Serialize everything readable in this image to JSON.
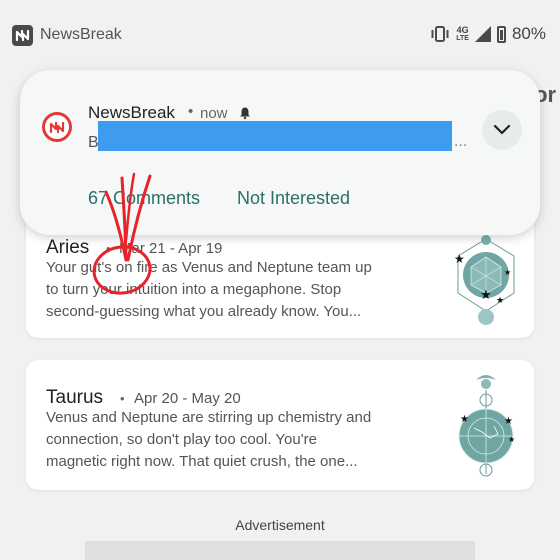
{
  "statusbar": {
    "app_name": "NewsBreak",
    "network": "4G",
    "network_sub": "LTE",
    "battery": "80%"
  },
  "background_peek": {
    "edge_text": "lor"
  },
  "notification": {
    "app_name": "NewsBreak",
    "separator": "•",
    "time": "now",
    "preview_start": "B",
    "preview_end": "...",
    "actions": {
      "comments": "67 Comments",
      "not_interested": "Not Interested"
    },
    "colors": {
      "action": "#2c6f68",
      "redaction": "#3d9bf0",
      "annotation": "#e8222a"
    }
  },
  "feed": [
    {
      "sign": "Aries",
      "dot": "•",
      "dates": "Mar 21 - Apr 19",
      "lines": [
        "Your gut's on fire as Venus and Neptune team up",
        "to turn your intuition into a megaphone. Stop",
        "second-guessing what you already know. You..."
      ],
      "icon": "aries-zodiac-illustration"
    },
    {
      "sign": "Taurus",
      "dot": "•",
      "dates": "Apr 20 - May 20",
      "lines": [
        "Venus and Neptune are stirring up chemistry and",
        "connection, so don't play too cool. You're",
        "magnetic right now. That quiet crush, the one..."
      ],
      "icon": "taurus-zodiac-illustration"
    }
  ],
  "advertisement": {
    "label": "Advertisement"
  }
}
